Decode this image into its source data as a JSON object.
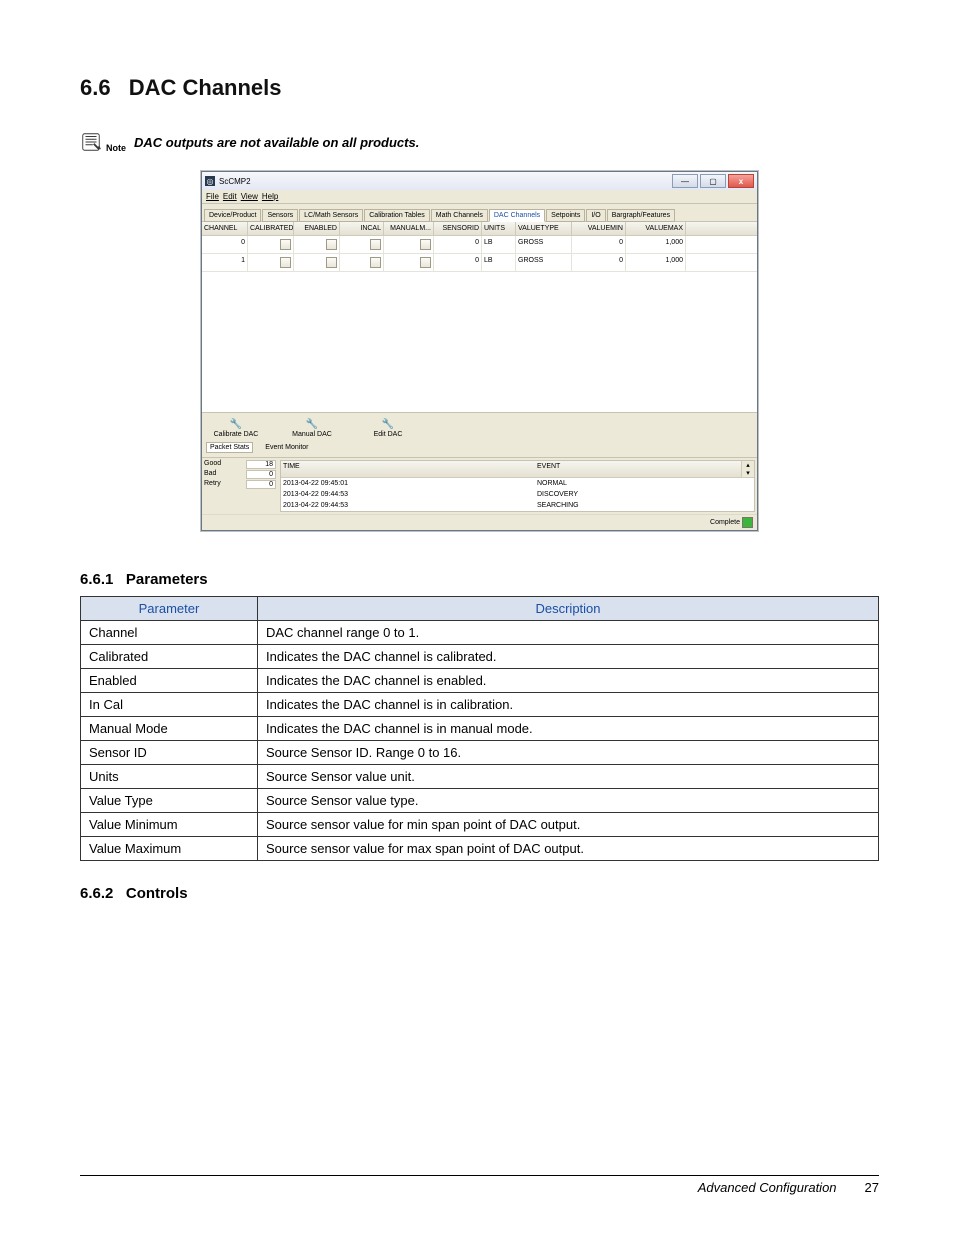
{
  "heading": {
    "number": "6.6",
    "title": "DAC Channels"
  },
  "note": {
    "label": "Note",
    "text": "DAC outputs are not available on all products."
  },
  "app": {
    "title": "ScCMP2",
    "menus": [
      "File",
      "Edit",
      "View",
      "Help"
    ],
    "window_buttons": {
      "min": "—",
      "max": "▢",
      "close": "x"
    },
    "tabs": [
      "Device/Product",
      "Sensors",
      "LC/Math Sensors",
      "Calibration Tables",
      "Math Channels",
      "DAC Channels",
      "Setpoints",
      "I/O",
      "Bargraph/Features"
    ],
    "active_tab": "DAC Channels",
    "columns": [
      "CHANNEL",
      "CALIBRATED",
      "ENABLED",
      "INCAL",
      "MANUALM...",
      "SENSORID",
      "UNITS",
      "VALUETYPE",
      "VALUEMIN",
      "VALUEMAX"
    ],
    "rows": [
      {
        "channel": "0",
        "sensorid": "0",
        "units": "LB",
        "valuetype": "GROSS",
        "valuemin": "0",
        "valuemax": "1,000"
      },
      {
        "channel": "1",
        "sensorid": "0",
        "units": "LB",
        "valuetype": "GROSS",
        "valuemin": "0",
        "valuemax": "1,000"
      }
    ],
    "tools": [
      "Calibrate DAC",
      "Manual DAC",
      "Edit DAC"
    ],
    "panel_tabs": [
      "Packet Stats",
      "Event Monitor"
    ],
    "stats": {
      "Good": "18",
      "Bad": "0",
      "Retry": "0"
    },
    "events_header": {
      "time": "TIME",
      "event": "EVENT"
    },
    "events": [
      {
        "time": "2013-04-22 09:45:01",
        "event": "NORMAL"
      },
      {
        "time": "2013-04-22 09:44:53",
        "event": "DISCOVERY"
      },
      {
        "time": "2013-04-22 09:44:53",
        "event": "SEARCHING"
      }
    ],
    "status_label": "Complete"
  },
  "sub1": {
    "number": "6.6.1",
    "title": "Parameters"
  },
  "param_table": {
    "head": {
      "p": "Parameter",
      "d": "Description"
    },
    "rows": [
      [
        "Channel",
        "DAC channel range 0 to 1."
      ],
      [
        "Calibrated",
        "Indicates the DAC channel is calibrated."
      ],
      [
        "Enabled",
        "Indicates the DAC channel is enabled."
      ],
      [
        "In Cal",
        "Indicates the DAC channel is in calibration."
      ],
      [
        "Manual Mode",
        "Indicates the DAC channel is in manual mode."
      ],
      [
        "Sensor ID",
        "Source Sensor ID. Range 0 to 16."
      ],
      [
        "Units",
        "Source Sensor value unit."
      ],
      [
        "Value Type",
        "Source Sensor value type."
      ],
      [
        "Value Minimum",
        "Source sensor value for min span point of DAC output."
      ],
      [
        "Value Maximum",
        "Source sensor value for max span point of DAC output."
      ]
    ]
  },
  "sub2": {
    "number": "6.6.2",
    "title": "Controls"
  },
  "footer": {
    "title": "Advanced Configuration",
    "page": "27"
  }
}
